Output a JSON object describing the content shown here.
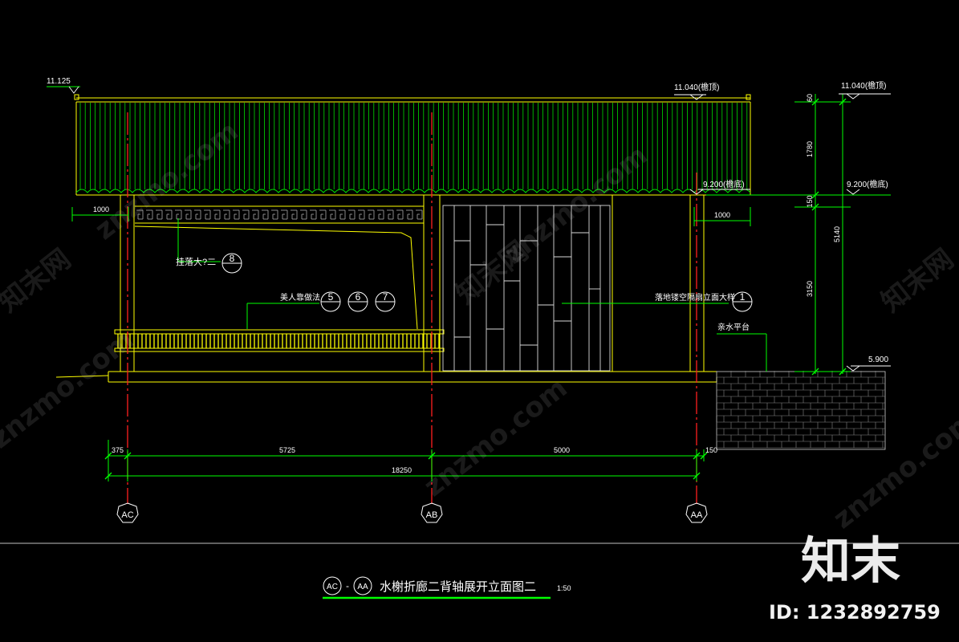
{
  "elevations": {
    "left_top": "11.125",
    "ridge_label": "11.040(檐顶)",
    "eave_label": "9.200(檐底)",
    "right_ridge_label": "11.040(檐顶)",
    "right_eave_label": "9.200(檐底)",
    "platform": "5.900"
  },
  "vertical_dims": {
    "d60": "60",
    "d1780": "1780",
    "d150": "150",
    "d3150": "3150",
    "d5140": "5140"
  },
  "horizontal_dims": {
    "left_1000": "1000",
    "right_1000": "1000",
    "d375": "375",
    "d5725": "5725",
    "d5000": "5000",
    "d150": "150",
    "total": "18250"
  },
  "callouts": {
    "hanging_label": "挂落大?二",
    "hanging_ref": "8",
    "bench_label": "美人靠做法",
    "bench_refs": [
      "5",
      "6",
      "7"
    ],
    "screen_label": "落地镂空隔扇立面大样",
    "screen_ref": "1",
    "platform_label": "亲水平台"
  },
  "axes": {
    "left": "AC",
    "mid": "AB",
    "right": "AA"
  },
  "title": {
    "from": "AC",
    "to": "AA",
    "dash": "-",
    "text": "水榭折廊二背轴展开立面图二",
    "scale": "1:50"
  },
  "watermarks": {
    "site": "znzmo.com",
    "brand_cn": "知末网",
    "brand_big": "知末",
    "id": "ID: 1232892759"
  },
  "colors": {
    "line": "#ffff00",
    "dim": "#00ff00",
    "axis": "#ff0000",
    "text": "#ffffff",
    "background": "#000000"
  }
}
